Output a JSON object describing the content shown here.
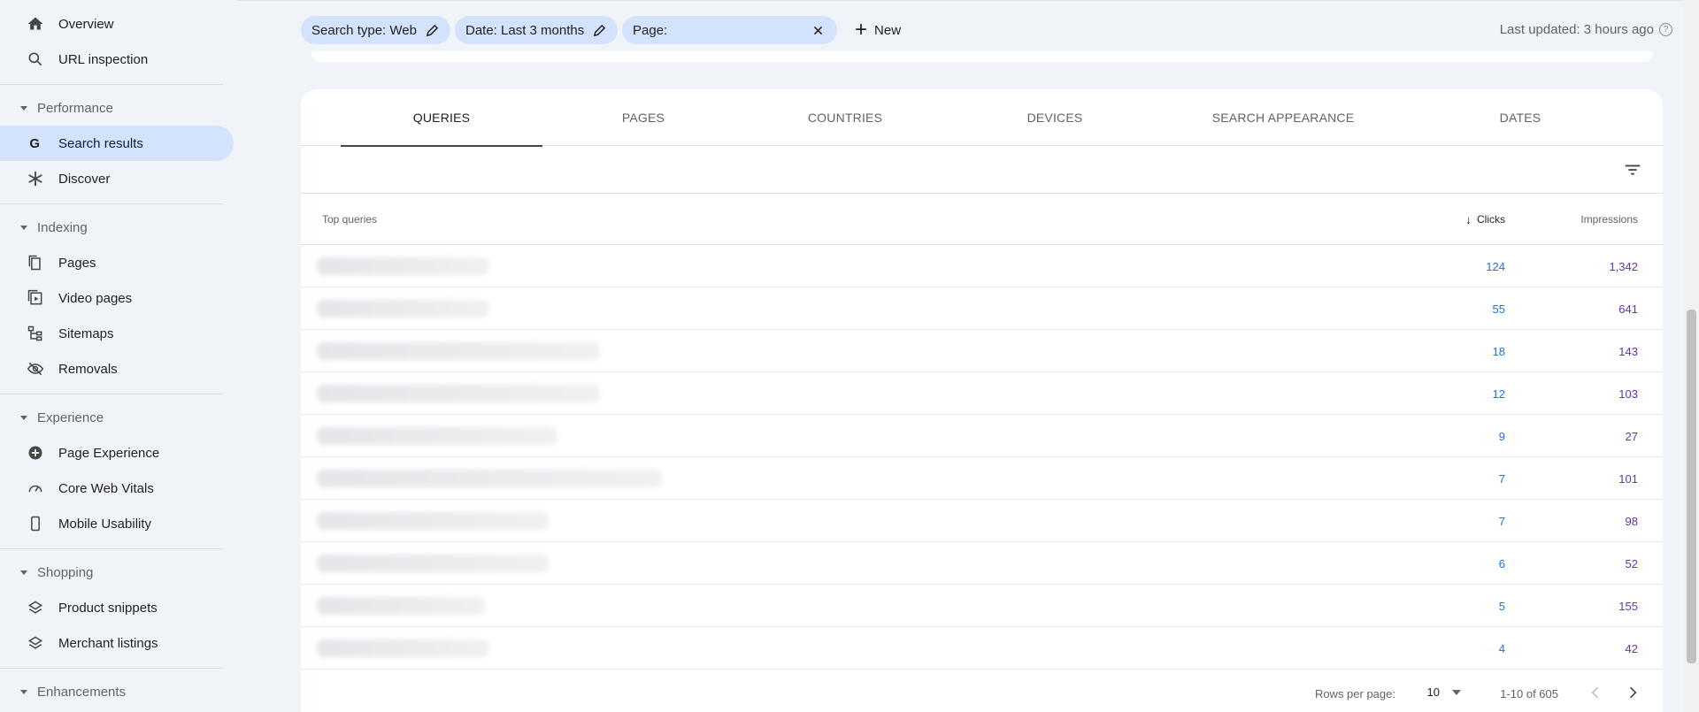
{
  "sidebar": {
    "overview": "Overview",
    "url_inspection": "URL inspection",
    "performance": "Performance",
    "search_results": "Search results",
    "discover": "Discover",
    "indexing": "Indexing",
    "pages": "Pages",
    "video_pages": "Video pages",
    "sitemaps": "Sitemaps",
    "removals": "Removals",
    "experience": "Experience",
    "page_experience": "Page Experience",
    "core_web_vitals": "Core Web Vitals",
    "mobile_usability": "Mobile Usability",
    "shopping": "Shopping",
    "product_snippets": "Product snippets",
    "merchant_listings": "Merchant listings",
    "enhancements": "Enhancements"
  },
  "filters": {
    "search_type": "Search type: Web",
    "date": "Date: Last 3 months",
    "page": "Page:",
    "new_label": "New",
    "last_updated": "Last updated: 3 hours ago"
  },
  "tabs": {
    "queries": "QUERIES",
    "pages": "PAGES",
    "countries": "COUNTRIES",
    "devices": "DEVICES",
    "search_appearance": "SEARCH APPEARANCE",
    "dates": "DATES"
  },
  "table": {
    "col_query": "Top queries",
    "col_clicks": "Clicks",
    "col_impressions": "Impressions",
    "rows": [
      {
        "clicks": "124",
        "impressions": "1,342"
      },
      {
        "clicks": "55",
        "impressions": "641"
      },
      {
        "clicks": "18",
        "impressions": "143"
      },
      {
        "clicks": "12",
        "impressions": "103"
      },
      {
        "clicks": "9",
        "impressions": "27"
      },
      {
        "clicks": "7",
        "impressions": "101"
      },
      {
        "clicks": "7",
        "impressions": "98"
      },
      {
        "clicks": "6",
        "impressions": "52"
      },
      {
        "clicks": "5",
        "impressions": "155"
      },
      {
        "clicks": "4",
        "impressions": "42"
      }
    ]
  },
  "pager": {
    "rows_per_page_label": "Rows per page:",
    "rows_per_page_value": "10",
    "range": "1-10 of 605"
  },
  "colors": {
    "active_nav": "#d3e3fd",
    "clicks": "#1a73e8",
    "impressions": "#5e35b1"
  }
}
